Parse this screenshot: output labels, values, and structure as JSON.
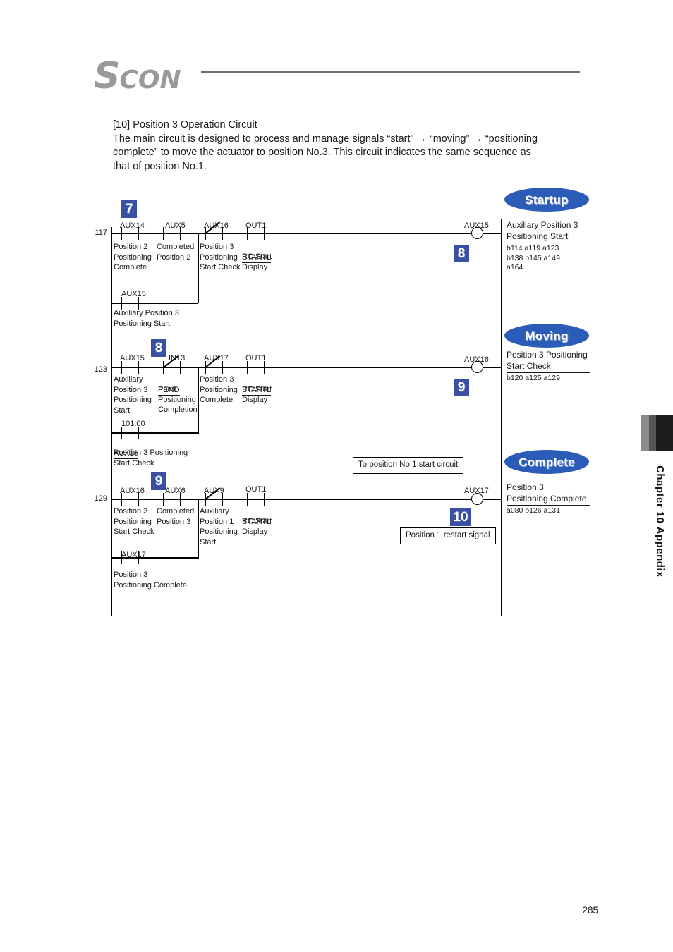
{
  "header": {
    "logo_s": "S",
    "logo_con": "CON"
  },
  "intro": {
    "heading": "[10] Position 3 Operation Circuit",
    "line1": "The main circuit is designed to process and manage signals “start” → “moving” → “positioning",
    "line2": "complete” to move the actuator to position No.3. This circuit indicates the same sequence as",
    "line3": "that of position No.1."
  },
  "colors": {
    "badge_square": "#3a51a3",
    "badge_oval": "#2b5cb8",
    "rail": "#000000"
  },
  "ladder": {
    "rungs": [
      {
        "number": "117",
        "step_badge": "7",
        "coil_badge": "8",
        "contacts": [
          {
            "tag": "AUX14",
            "type": "no",
            "desc": "Position 2\nPositioning\nComplete"
          },
          {
            "tag": "AUX5",
            "type": "no",
            "desc": "Completed\nPosition 2"
          },
          {
            "tag": "AUX16",
            "type": "nc",
            "desc": "Position 3\nPositioning\nStart Check"
          },
          {
            "tag": "OUT1",
            "type": "no",
            "desc_underlined": "STARTL",
            "desc": "RC Start\nDisplay"
          }
        ],
        "branch": {
          "tag": "AUX15",
          "type": "no",
          "desc": "Auxiliary Position 3\nPositioning Start"
        },
        "coil_tag": "AUX15",
        "state_badge": "Startup",
        "out_label": "Auxiliary Position 3\nPositioning Start",
        "out_codes": "b114 a119 a123\nb138 b145 a149\na164"
      },
      {
        "number": "123",
        "step_badge": "8",
        "coil_badge": "9",
        "contacts": [
          {
            "tag": "AUX15",
            "type": "no",
            "desc": "Auxiliary\nPosition 3\nPositioning\nStart"
          },
          {
            "tag": "IN13",
            "type": "nc",
            "desc_underlined": "PEND",
            "desc": "Point\nPositioning\nCompletion"
          },
          {
            "tag": "AUX17",
            "type": "nc",
            "desc": "Position 3\nPositioning\nComplete"
          },
          {
            "tag": "OUT1",
            "type": "no",
            "desc_underlined": "STARTL",
            "desc": "RC Start\nDisplay"
          }
        ],
        "branch": {
          "tag": "101.00",
          "type": "no",
          "desc_underlined": "AUX16",
          "desc": "Position 3 Positioning\nStart Check"
        },
        "coil_tag": "AUX16",
        "state_badge": "Moving",
        "out_label": "Position 3 Positioning\nStart Check",
        "out_codes": "b120 a125 a129"
      },
      {
        "number": "129",
        "step_badge": "9",
        "coil_badge": "10",
        "contacts": [
          {
            "tag": "AUX16",
            "type": "no",
            "desc": "Position 3\nPositioning\nStart Check"
          },
          {
            "tag": "AUX6",
            "type": "no",
            "desc": "Completed\nPosition 3"
          },
          {
            "tag": "AUX9",
            "type": "nc",
            "desc": "Auxiliary\nPosition 1\nPositioning\nStart"
          },
          {
            "tag": "OUT1",
            "type": "no",
            "desc_underlined": "STARTL",
            "desc": "RC Start\nDisplay"
          }
        ],
        "branch": {
          "tag": "AUX17",
          "type": "no",
          "desc": "Position 3\nPositioning Complete"
        },
        "coil_tag": "AUX17",
        "state_badge": "Complete",
        "out_label": "Position 3\nPositioning Complete",
        "out_codes": "a080 b126 a131"
      }
    ],
    "notes": [
      {
        "text": "To position No.1 start circuit"
      },
      {
        "text": "Position 1 restart signal"
      }
    ]
  },
  "footer": {
    "chapter": "Chapter 10 Appendix",
    "page_number": "285"
  }
}
